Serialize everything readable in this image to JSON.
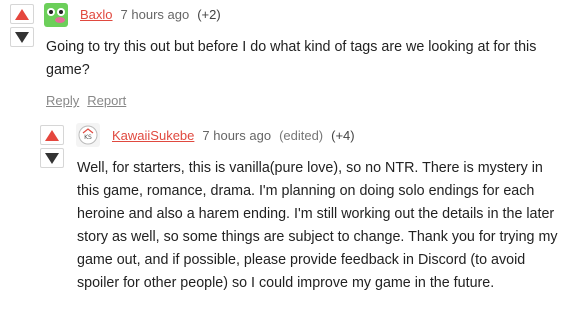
{
  "comments": [
    {
      "username": "Baxlo",
      "time": "7 hours ago",
      "score": "(+2)",
      "body": "Going to try this out but before I do what kind of tags are we looking at for this game?",
      "actions": {
        "reply": "Reply",
        "report": "Report"
      },
      "avatar_color": "#6ccf5a"
    },
    {
      "username": "KawaiiSukebe",
      "time": "7 hours ago",
      "edited": "(edited)",
      "score": "(+4)",
      "body": "Well, for starters, this is vanilla(pure love), so no NTR. There is mystery in this game, romance, drama. I'm planning on doing solo endings for each heroine and also a harem ending. I'm still working out the details in the later story as well, so some things are subject to change. Thank you for trying my game out, and if possible, please provide feedback in Discord (to avoid spoiler for other people) so I could improve my game in the future."
    }
  ],
  "colors": {
    "upvote": "#e5463d",
    "downvote": "#333333",
    "username": "#e0493f"
  },
  "icons": {
    "upvote": "triangle-up-icon",
    "downvote": "triangle-down-icon"
  }
}
